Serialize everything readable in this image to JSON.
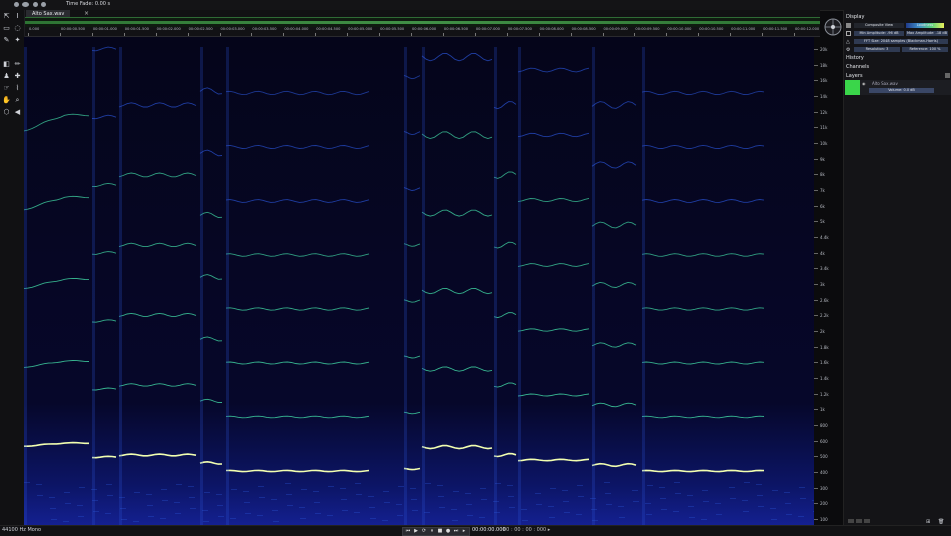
{
  "topbar": {
    "time_fade": "Time Fade: 0.00 s"
  },
  "tab": {
    "name": "Alto Sax.wav",
    "close": "×"
  },
  "ruler": {
    "ticks": [
      "0.000",
      "00:00:00.500",
      "00:00:01.000",
      "00:00:01.500",
      "00:00:02.000",
      "00:00:02.500",
      "00:00:03.000",
      "00:00:03.500",
      "00:00:04.000",
      "00:00:04.500",
      "00:00:05.000",
      "00:00:05.500",
      "00:00:06.000",
      "00:00:06.500",
      "00:00:07.000",
      "00:00:07.500",
      "00:00:08.000",
      "00:00:08.500",
      "00:00:09.000",
      "00:00:09.500",
      "00:00:10.000",
      "00:00:10.500",
      "00:00:11.000",
      "00:00:11.500",
      "00:00:12.000"
    ]
  },
  "freq_axis": {
    "labels": [
      "20k",
      "18k",
      "16k",
      "14k",
      "12k",
      "11k",
      "10k",
      "9k",
      "8k",
      "7k",
      "6k",
      "5k",
      "4.4k",
      "4k",
      "3.4k",
      "3k",
      "2.6k",
      "2.2k",
      "2k",
      "1.8k",
      "1.6k",
      "1.4k",
      "1.2k",
      "1k",
      "800",
      "600",
      "500",
      "400",
      "300",
      "200",
      "100"
    ]
  },
  "panel": {
    "display_title": "Display",
    "composite_view": "Composite View",
    "colormap": "Loudness",
    "min_amp": "Min Amplitude: -96 dB",
    "max_amp": "Max Amplitude: -18 dB",
    "fft": "FFT Size: 2048 samples (Blackman-Harris)",
    "resolution": "Resolution: 3",
    "reference": "Reference: 100 %",
    "history_title": "History",
    "channels_title": "Channels",
    "layers_title": "Layers",
    "layer_name": "Alto Sax.wav",
    "layer_volume": "Volume: 0.0 dB"
  },
  "bottom": {
    "status": "44100 Hz Mono",
    "timecode": "00:00:00.000",
    "extra": "00 : 00 : 00 : 000  ▸"
  },
  "colors": {
    "spec_bg": "#05051a",
    "harmonic_bright": "#f2ffb0",
    "harmonic_mid": "#3fd0a0",
    "harmonic_dim": "#2a55d8",
    "layer_green": "#3ad64a"
  }
}
